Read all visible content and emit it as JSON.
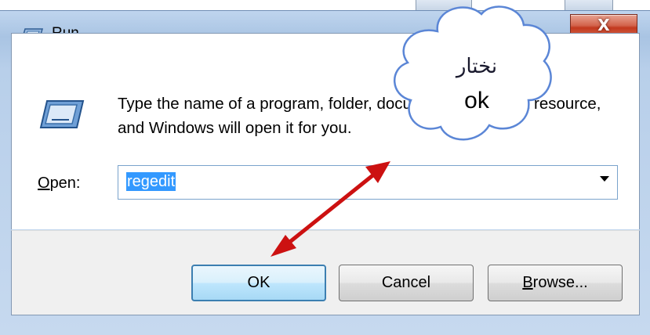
{
  "window": {
    "title": "Run",
    "close_glyph": "X"
  },
  "dialog": {
    "description": "Type the name of a program, folder, document, or Internet resource, and Windows will open it for you.",
    "open_label_underlined": "O",
    "open_label_rest": "pen:",
    "open_value": "regedit"
  },
  "buttons": {
    "ok": "OK",
    "cancel": "Cancel",
    "browse_underlined": "B",
    "browse_rest": "rowse..."
  },
  "callout": {
    "line1": "نختار",
    "line2": "ok"
  },
  "colors": {
    "selection": "#3399ff",
    "arrow": "#cc1111",
    "ok_border": "#3c7fb1",
    "close_button": "#c2391f"
  },
  "icons": [
    "run-app-icon",
    "close-icon",
    "dropdown-arrow-icon",
    "double-arrow-icon"
  ]
}
